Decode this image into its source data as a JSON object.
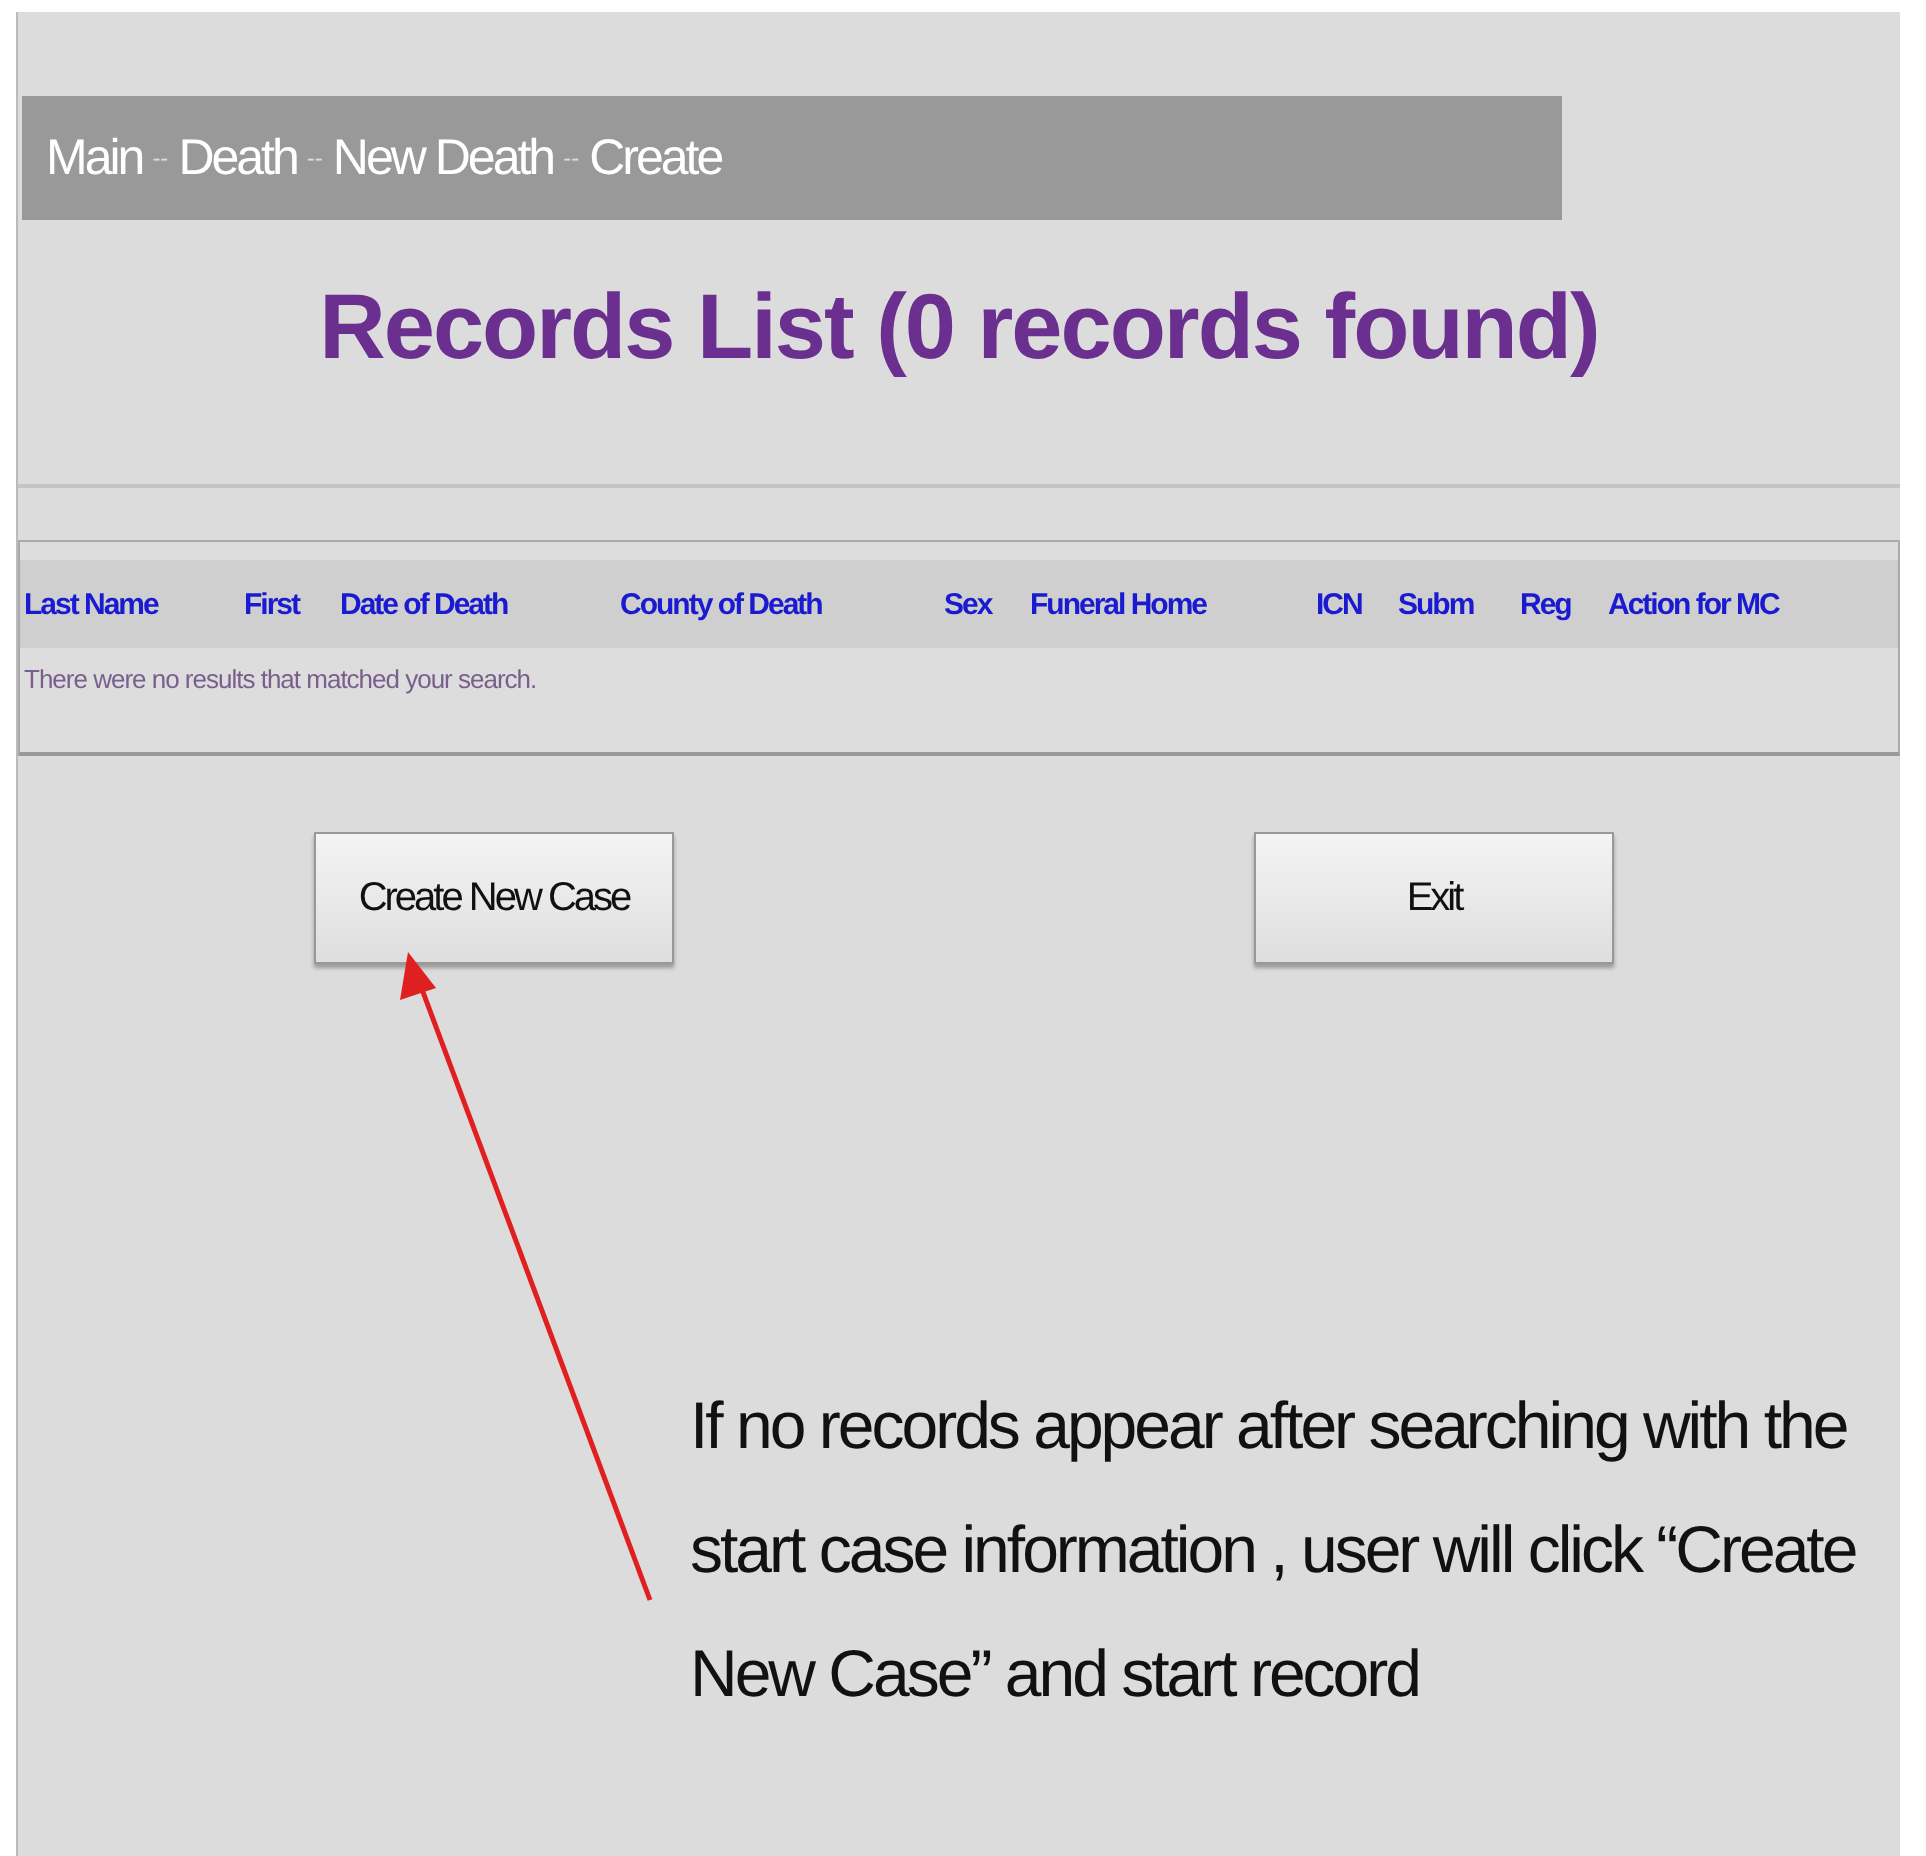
{
  "breadcrumb": [
    "Main",
    "Death",
    "New Death",
    "Create"
  ],
  "breadcrumb_separator": "--",
  "title": "Records List (0 records found)",
  "table": {
    "columns": [
      "Last Name",
      "First",
      "Date of Death",
      "County of Death",
      "Sex",
      "Funeral Home",
      "ICN",
      "Subm",
      "Reg",
      "Action for MC"
    ],
    "empty_message": "There were no results that matched your search."
  },
  "buttons": [
    "Create New Case",
    "Exit"
  ],
  "annotation": "If no records appear after searching with the start case information , user will click “Create New Case” and start record"
}
